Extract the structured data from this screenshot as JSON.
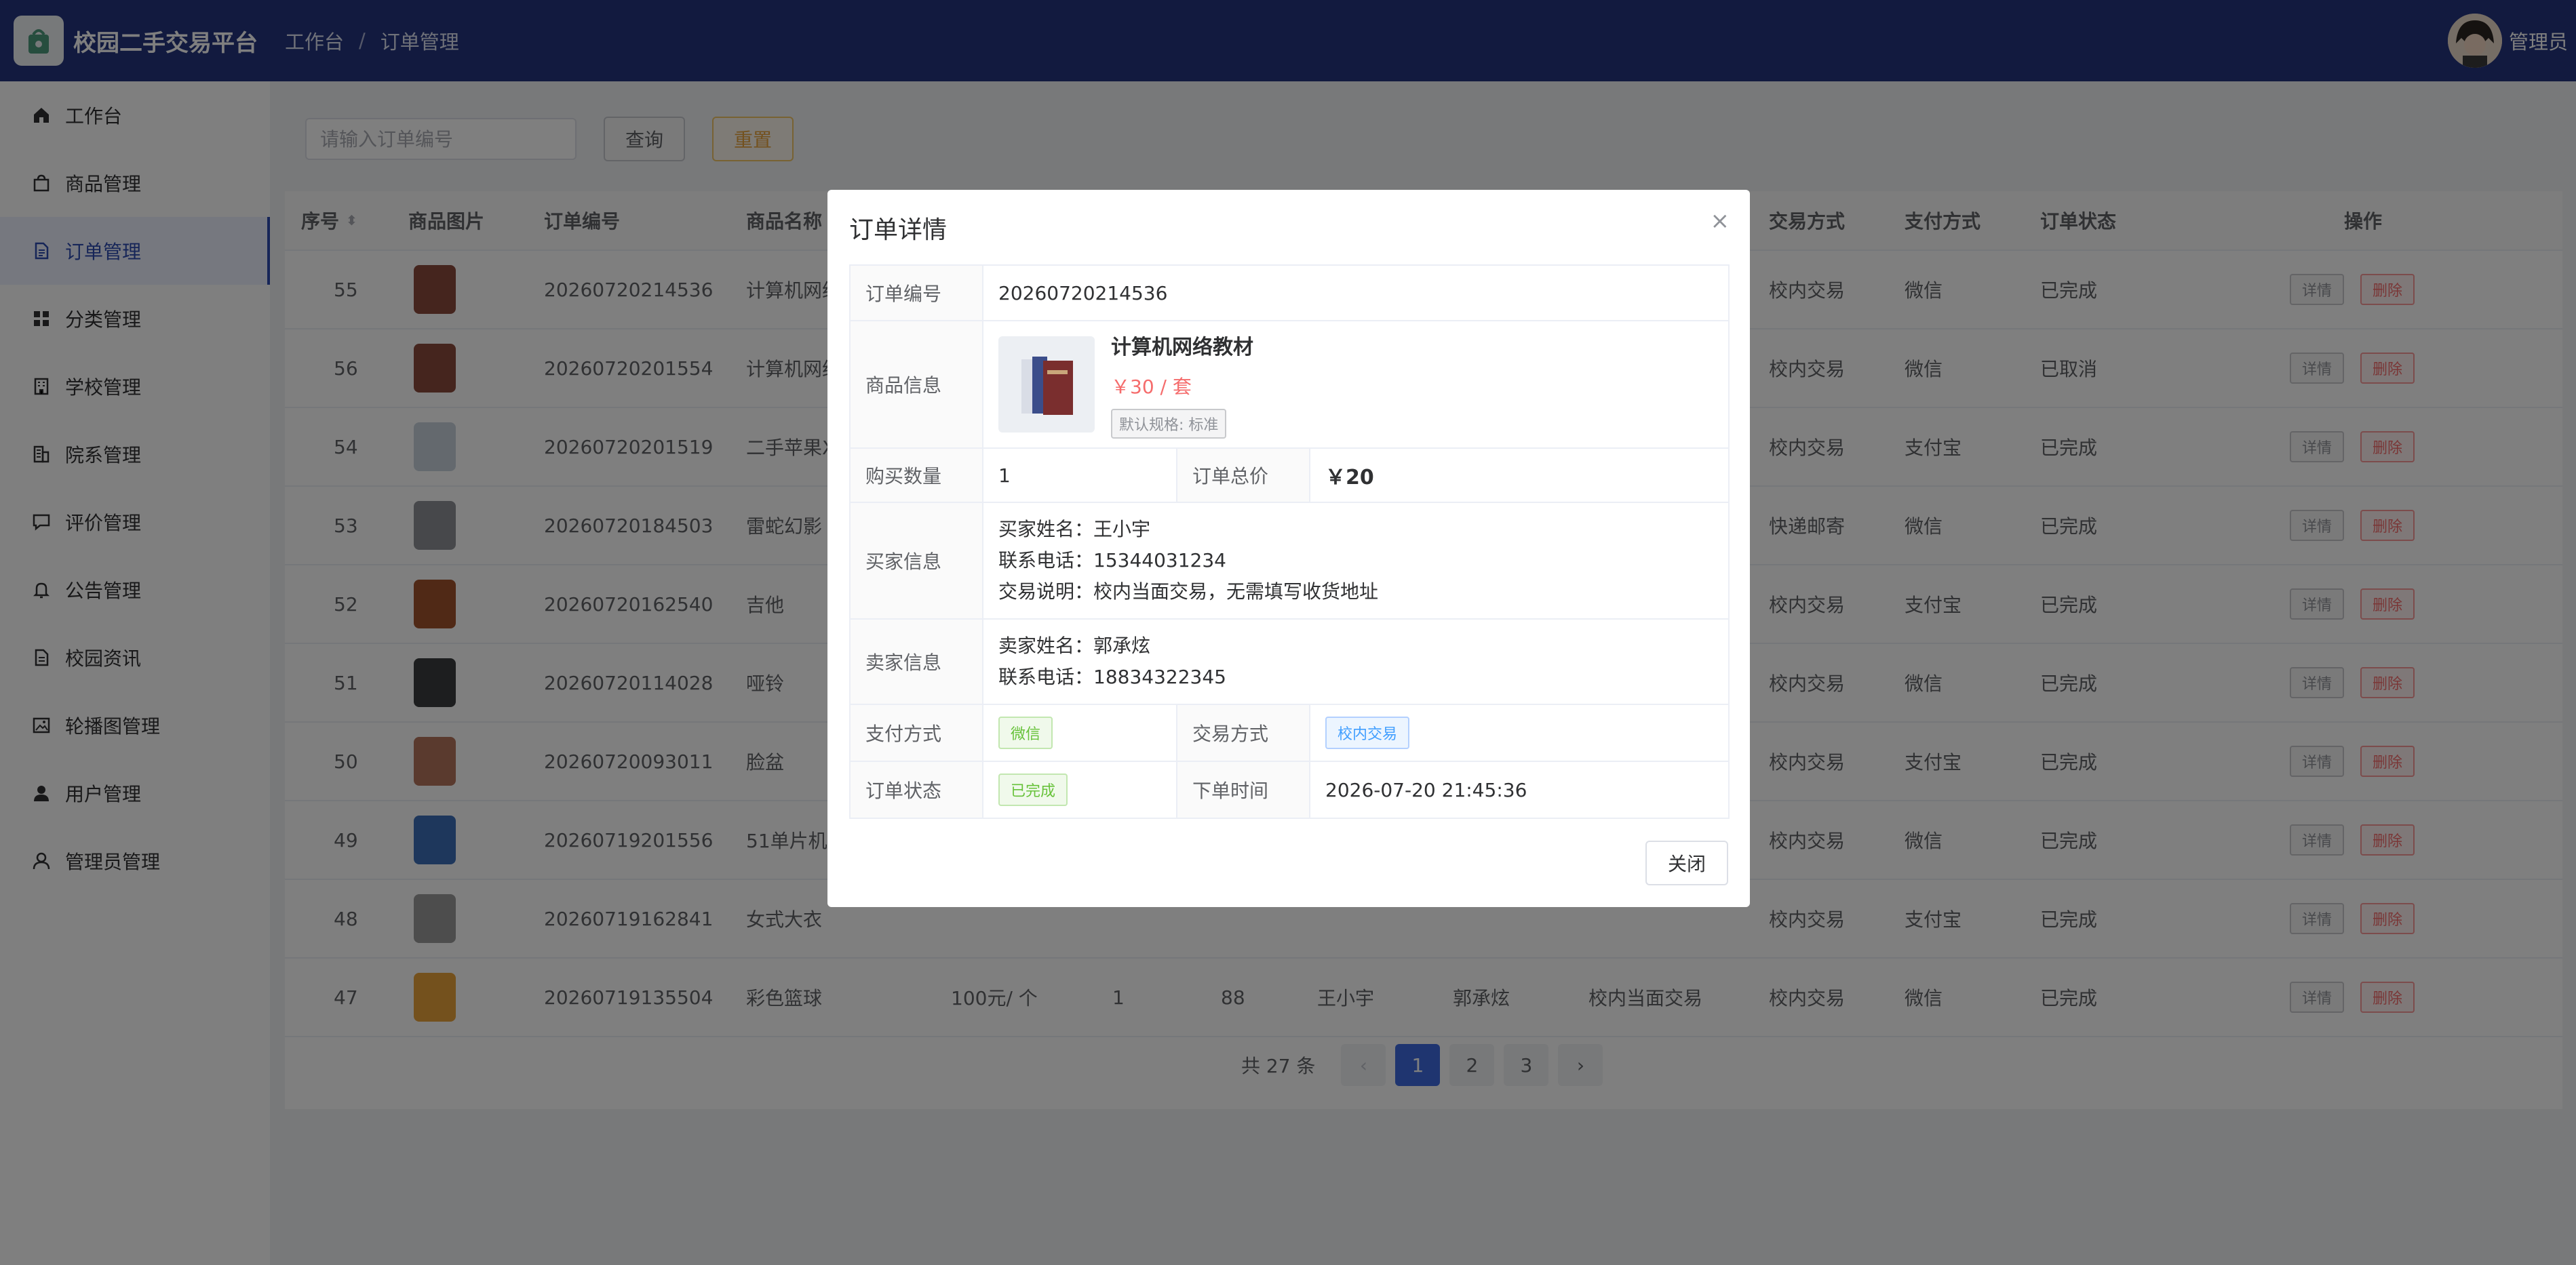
{
  "app": {
    "title": "校园二手交易平台"
  },
  "breadcrumb": [
    "工作台",
    "订单管理"
  ],
  "user": {
    "name": "管理员"
  },
  "sidebar": {
    "items": [
      {
        "label": "工作台",
        "icon": "home-icon",
        "active": false
      },
      {
        "label": "商品管理",
        "icon": "bag-icon",
        "active": false
      },
      {
        "label": "订单管理",
        "icon": "document-icon",
        "active": true
      },
      {
        "label": "分类管理",
        "icon": "grid-icon",
        "active": false
      },
      {
        "label": "学校管理",
        "icon": "building-icon",
        "active": false
      },
      {
        "label": "院系管理",
        "icon": "office-icon",
        "active": false
      },
      {
        "label": "评价管理",
        "icon": "comment-icon",
        "active": false
      },
      {
        "label": "公告管理",
        "icon": "bell-icon",
        "active": false
      },
      {
        "label": "校园资讯",
        "icon": "news-icon",
        "active": false
      },
      {
        "label": "轮播图管理",
        "icon": "image-icon",
        "active": false
      },
      {
        "label": "用户管理",
        "icon": "user-icon",
        "active": false
      },
      {
        "label": "管理员管理",
        "icon": "admin-icon",
        "active": false
      }
    ]
  },
  "search": {
    "placeholder": "请输入订单编号",
    "value": "",
    "query_label": "查询",
    "reset_label": "重置"
  },
  "table": {
    "columns": [
      "序号",
      "商品图片",
      "订单编号",
      "商品名称",
      "交易方式",
      "支付方式",
      "订单状态",
      "操作"
    ],
    "detail_label": "详情",
    "delete_label": "删除",
    "rows": [
      {
        "no": "55",
        "order_no": "20260720214536",
        "name": "计算机网络",
        "trade": "校内交易",
        "pay": "微信",
        "status": "已完成",
        "thumb": "#8a4a3d"
      },
      {
        "no": "56",
        "order_no": "20260720201554",
        "name": "计算机网络",
        "trade": "校内交易",
        "pay": "微信",
        "status": "已取消",
        "thumb": "#8a4a3d"
      },
      {
        "no": "54",
        "order_no": "20260720201519",
        "name": "二手苹果X",
        "trade": "校内交易",
        "pay": "支付宝",
        "status": "已完成",
        "thumb": "#c9d3dd"
      },
      {
        "no": "53",
        "order_no": "20260720184503",
        "name": "雷蛇幻影",
        "trade": "快递邮寄",
        "pay": "微信",
        "status": "已完成",
        "thumb": "#8e9196"
      },
      {
        "no": "52",
        "order_no": "20260720162540",
        "name": "吉他",
        "trade": "校内交易",
        "pay": "支付宝",
        "status": "已完成",
        "thumb": "#a0522d"
      },
      {
        "no": "51",
        "order_no": "20260720114028",
        "name": "哑铃",
        "trade": "校内交易",
        "pay": "微信",
        "status": "已完成",
        "thumb": "#3a3d3f"
      },
      {
        "no": "50",
        "order_no": "20260720093011",
        "name": "脸盆",
        "trade": "校内交易",
        "pay": "支付宝",
        "status": "已完成",
        "thumb": "#b4745c"
      },
      {
        "no": "49",
        "order_no": "20260719201556",
        "name": "51单片机",
        "trade": "校内交易",
        "pay": "微信",
        "status": "已完成",
        "thumb": "#3c6fb8"
      },
      {
        "no": "48",
        "order_no": "20260719162841",
        "name": "女式大衣",
        "trade": "校内交易",
        "pay": "支付宝",
        "status": "已完成",
        "thumb": "#9a9a9a"
      },
      {
        "no": "47",
        "order_no": "20260719135504",
        "name": "彩色篮球",
        "price": "100元/ 个",
        "qty": "1",
        "total": "88",
        "buyer": "王小宇",
        "seller": "郭承炫",
        "note": "校内当面交易",
        "trade": "校内交易",
        "pay": "微信",
        "status": "已完成",
        "thumb": "#e9a23b"
      }
    ]
  },
  "pagination": {
    "total_text": "共 27 条",
    "pages": [
      "1",
      "2",
      "3"
    ],
    "current": "1",
    "prev": "‹",
    "next": "›"
  },
  "dialog": {
    "title": "订单详情",
    "close_icon": "×",
    "order_no_label": "订单编号",
    "order_no": "20260720214536",
    "product_label": "商品信息",
    "product_name": "计算机网络教材",
    "product_price": "￥30 / 套",
    "product_spec": "默认规格: 标准",
    "qty_label": "购买数量",
    "qty": "1",
    "total_label": "订单总价",
    "total": "￥20",
    "buyer_label": "买家信息",
    "buyer_name": "买家姓名：王小宇",
    "buyer_phone": "联系电话：15344031234",
    "buyer_note": "交易说明：校内当面交易，无需填写收货地址",
    "seller_label": "卖家信息",
    "seller_name": "卖家姓名：郭承炫",
    "seller_phone": "联系电话：18834322345",
    "pay_label": "支付方式",
    "pay": "微信",
    "trade_label": "交易方式",
    "trade": "校内交易",
    "status_label": "订单状态",
    "status": "已完成",
    "time_label": "下单时间",
    "time": "2026-07-20 21:45:36",
    "close_label": "关闭"
  }
}
